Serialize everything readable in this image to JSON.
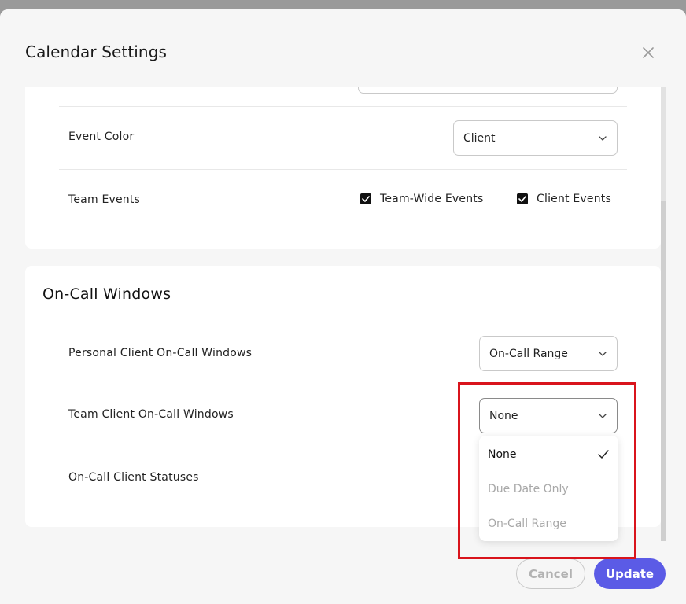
{
  "dialog": {
    "title": "Calendar Settings"
  },
  "general": {
    "event_color": {
      "label": "Event Color",
      "value": "Client"
    },
    "team_events": {
      "label": "Team Events",
      "options": [
        {
          "label": "Team-Wide Events",
          "checked": true
        },
        {
          "label": "Client Events",
          "checked": true
        }
      ]
    }
  },
  "on_call": {
    "title": "On-Call Windows",
    "personal": {
      "label": "Personal Client On-Call Windows",
      "value": "On-Call Range"
    },
    "team": {
      "label": "Team Client On-Call Windows",
      "value": "None"
    },
    "statuses": {
      "label": "On-Call Client Statuses"
    }
  },
  "dropdown": {
    "options": [
      {
        "label": "None",
        "selected": true,
        "disabled": false
      },
      {
        "label": "Due Date Only",
        "selected": false,
        "disabled": true
      },
      {
        "label": "On-Call Range",
        "selected": false,
        "disabled": true
      }
    ]
  },
  "footer": {
    "cancel_label": "Cancel",
    "update_label": "Update"
  },
  "colors": {
    "accent": "#5b5be6",
    "highlight": "#d9141c"
  },
  "icons": {
    "close": "close-icon",
    "chevron": "chevron-down-icon",
    "check": "checkmark-icon"
  }
}
